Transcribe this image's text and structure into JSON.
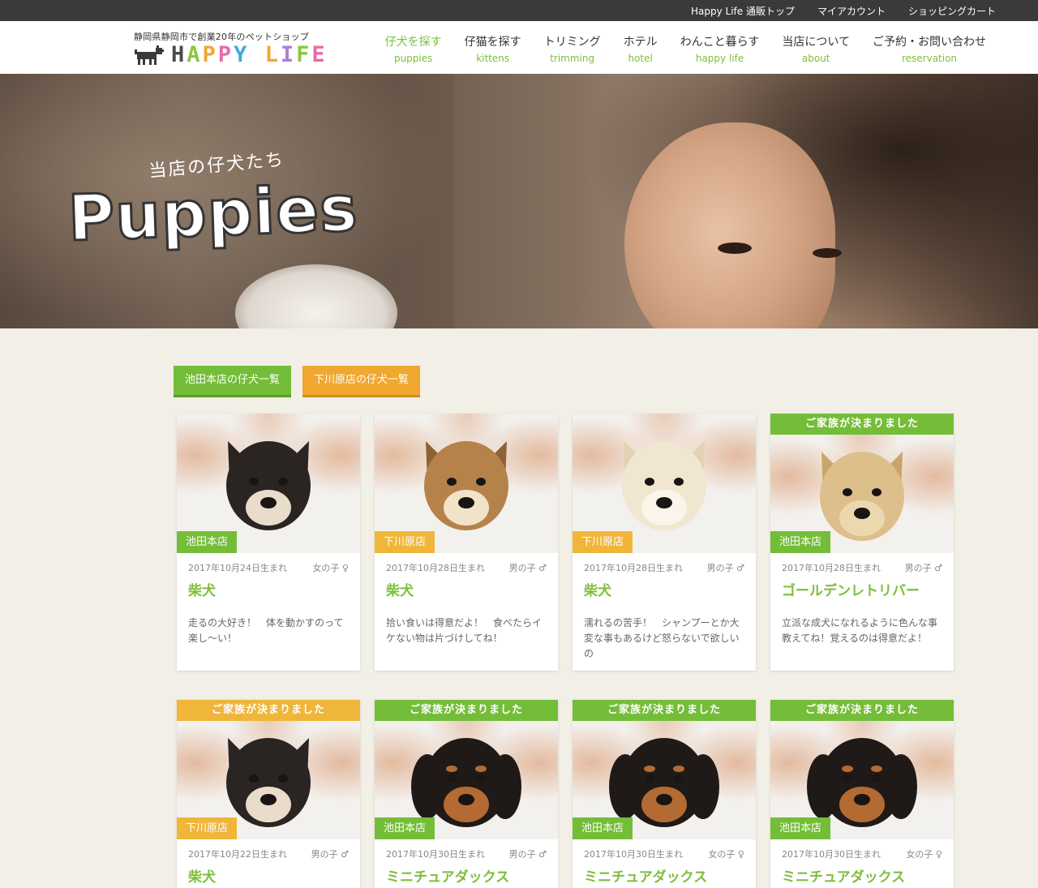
{
  "topbar": {
    "links": [
      "Happy Life 通販トップ",
      "マイアカウント",
      "ショッピングカート"
    ]
  },
  "header": {
    "tagline": "静岡県静岡市で創業20年のペットショップ",
    "logo_text": "HAPPY LIFE",
    "nav": [
      {
        "jp": "仔犬を探す",
        "en": "puppies"
      },
      {
        "jp": "仔猫を探す",
        "en": "kittens"
      },
      {
        "jp": "トリミング",
        "en": "trimming"
      },
      {
        "jp": "ホテル",
        "en": "hotel"
      },
      {
        "jp": "わんこと暮らす",
        "en": "happy life"
      },
      {
        "jp": "当店について",
        "en": "about"
      },
      {
        "jp": "ご予約・お問い合わせ",
        "en": "reservation"
      }
    ]
  },
  "hero": {
    "subtitle": "当店の仔犬たち",
    "title": "Puppies"
  },
  "filters": {
    "ikeda": "池田本店の仔犬一覧",
    "shimokawara": "下川原店の仔犬一覧"
  },
  "colors": {
    "green": "#74bd38",
    "orange": "#f0b63a"
  },
  "puppies": [
    {
      "banner": "",
      "shop": "池田本店",
      "shop_color": "green",
      "born": "2017年10月24日生まれ",
      "sex": "女の子 ♀",
      "breed": "柴犬",
      "desc": "走るの大好き！　体を動かすのって楽し〜い！",
      "fur": "black"
    },
    {
      "banner": "",
      "shop": "下川原店",
      "shop_color": "orange",
      "born": "2017年10月28日生まれ",
      "sex": "男の子 ♂",
      "breed": "柴犬",
      "desc": "拾い食いは得意だよ！　食べたらイケない物は片づけしてね！",
      "fur": "red"
    },
    {
      "banner": "",
      "shop": "下川原店",
      "shop_color": "orange",
      "born": "2017年10月28日生まれ",
      "sex": "男の子 ♂",
      "breed": "柴犬",
      "desc": "濡れるの苦手！　シャンプーとか大変な事もあるけど怒らないで欲しいの",
      "fur": "cream"
    },
    {
      "banner": "ご家族が決まりました",
      "banner_color": "green",
      "shop": "池田本店",
      "shop_color": "green",
      "born": "2017年10月28日生まれ",
      "sex": "男の子 ♂",
      "breed": "ゴールデンレトリバー",
      "desc": "立派な成犬になれるように色んな事教えてね！覚えるのは得意だよ！",
      "fur": "golden"
    },
    {
      "banner": "ご家族が決まりました",
      "banner_color": "orange",
      "shop": "下川原店",
      "shop_color": "orange",
      "born": "2017年10月22日生まれ",
      "sex": "男の子 ♂",
      "breed": "柴犬",
      "desc": "",
      "fur": "black"
    },
    {
      "banner": "ご家族が決まりました",
      "banner_color": "green",
      "shop": "池田本店",
      "shop_color": "green",
      "born": "2017年10月30日生まれ",
      "sex": "男の子 ♂",
      "breed": "ミニチュアダックス",
      "desc": "",
      "fur": "dachs"
    },
    {
      "banner": "ご家族が決まりました",
      "banner_color": "green",
      "shop": "池田本店",
      "shop_color": "green",
      "born": "2017年10月30日生まれ",
      "sex": "女の子 ♀",
      "breed": "ミニチュアダックス",
      "desc": "",
      "fur": "dachs"
    },
    {
      "banner": "ご家族が決まりました",
      "banner_color": "green",
      "shop": "池田本店",
      "shop_color": "green",
      "born": "2017年10月30日生まれ",
      "sex": "女の子 ♀",
      "breed": "ミニチュアダックス",
      "desc": "",
      "fur": "dachs"
    }
  ]
}
